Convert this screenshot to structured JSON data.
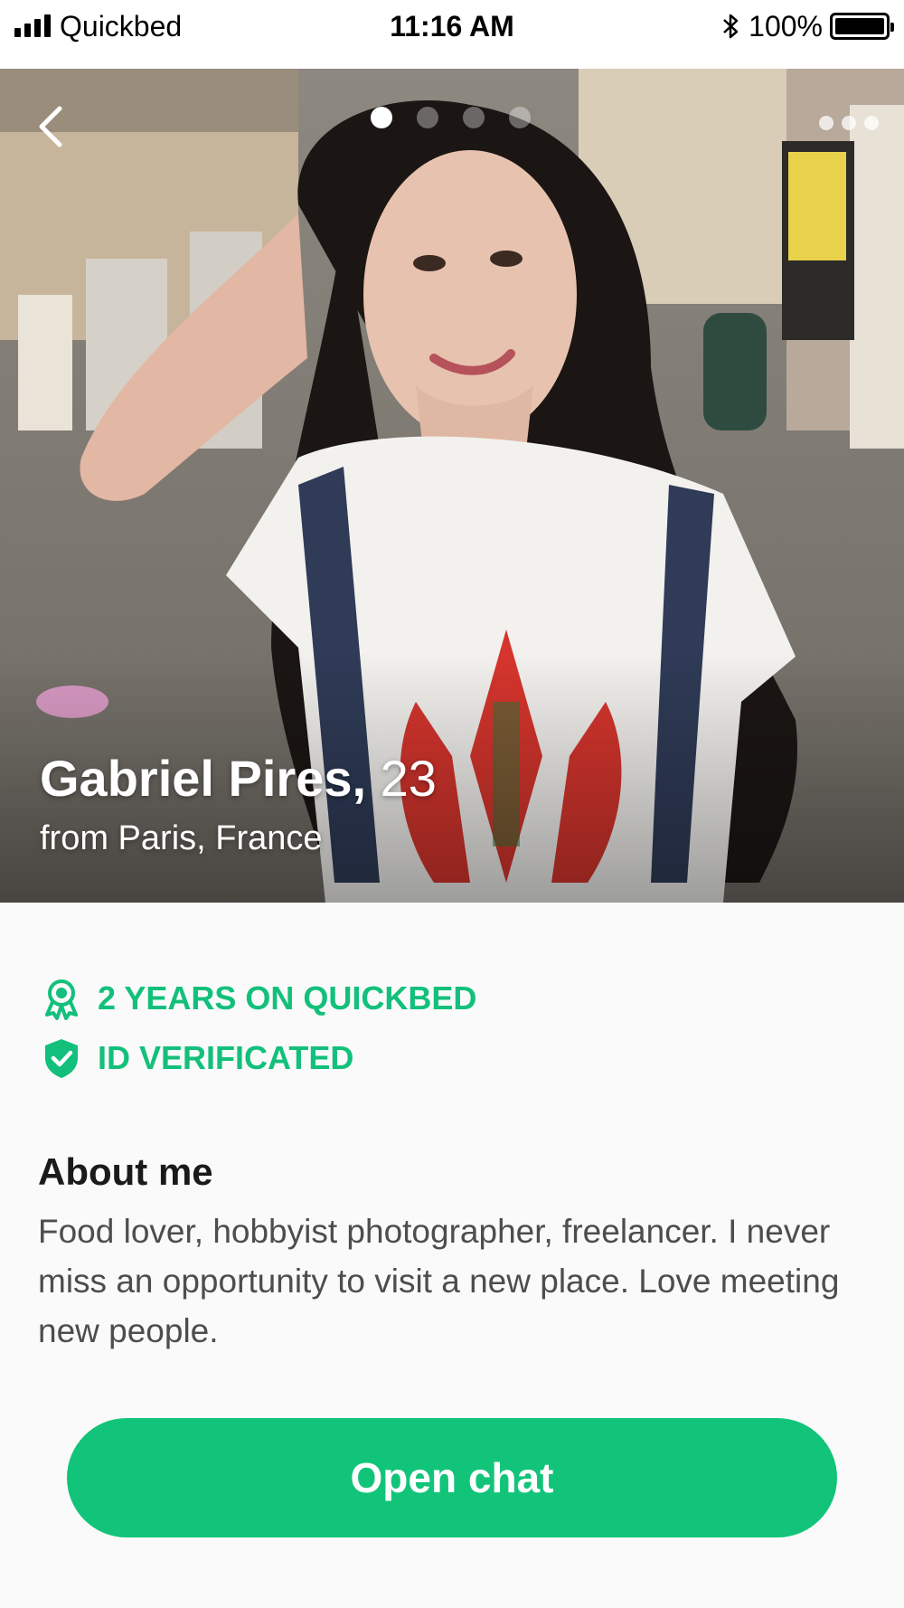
{
  "status_bar": {
    "carrier": "Quickbed",
    "time": "11:16 AM",
    "battery": "100%",
    "icons": [
      "signal-icon",
      "bluetooth-icon",
      "battery-icon"
    ]
  },
  "profile": {
    "name": "Gabriel Pires,",
    "age": "23",
    "location": "from Paris, France",
    "photo_count": 4,
    "active_photo": 1
  },
  "badges": [
    {
      "icon": "award-ribbon-icon",
      "label": "2 YEARS ON QUICKBED"
    },
    {
      "icon": "shield-check-icon",
      "label": "ID VERIFICATED"
    }
  ],
  "about": {
    "title": "About me",
    "text": "Food lover, hobbyist photographer, freelancer. I never miss an opportunity to visit a new place. Love meeting new people."
  },
  "actions": {
    "open_chat": "Open chat"
  },
  "colors": {
    "accent": "#12c479",
    "badge_text": "#13c07b",
    "body_text": "#4d4d4d"
  }
}
